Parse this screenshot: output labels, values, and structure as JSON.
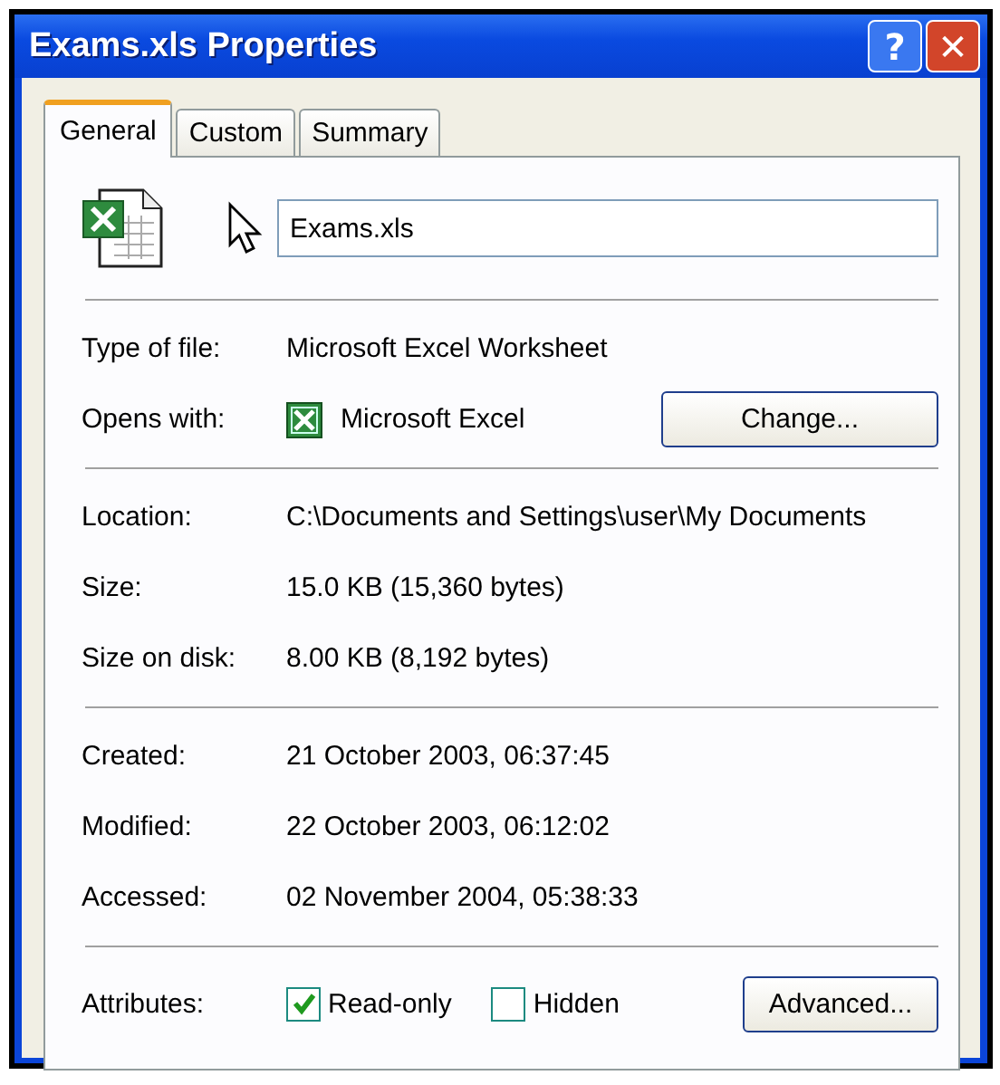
{
  "window": {
    "title": "Exams.xls Properties",
    "help_button": "?",
    "close_button": "✕"
  },
  "tabs": [
    {
      "label": "General",
      "selected": true
    },
    {
      "label": "Custom",
      "selected": false
    },
    {
      "label": "Summary",
      "selected": false
    }
  ],
  "file_name": {
    "value": "Exams.xls"
  },
  "sections": [
    [
      {
        "label": "Type of file:",
        "value": "Microsoft Excel Worksheet"
      },
      {
        "label": "Opens with:",
        "value": "Microsoft Excel",
        "kind": "app",
        "button": "Change..."
      }
    ],
    [
      {
        "label": "Location:",
        "value": "C:\\Documents and Settings\\user\\My Documents"
      },
      {
        "label": "Size:",
        "value": "15.0 KB (15,360 bytes)"
      },
      {
        "label": "Size on disk:",
        "value": "8.00 KB (8,192 bytes)"
      }
    ],
    [
      {
        "label": "Created:",
        "value": "21 October 2003, 06:37:45"
      },
      {
        "label": "Modified:",
        "value": "22 October 2003, 06:12:02"
      },
      {
        "label": "Accessed:",
        "value": "02 November 2004, 05:38:33"
      }
    ]
  ],
  "attributes": {
    "label": "Attributes:",
    "checkboxes": [
      {
        "label": "Read-only",
        "checked": true
      },
      {
        "label": "Hidden",
        "checked": false
      }
    ],
    "button": "Advanced..."
  }
}
